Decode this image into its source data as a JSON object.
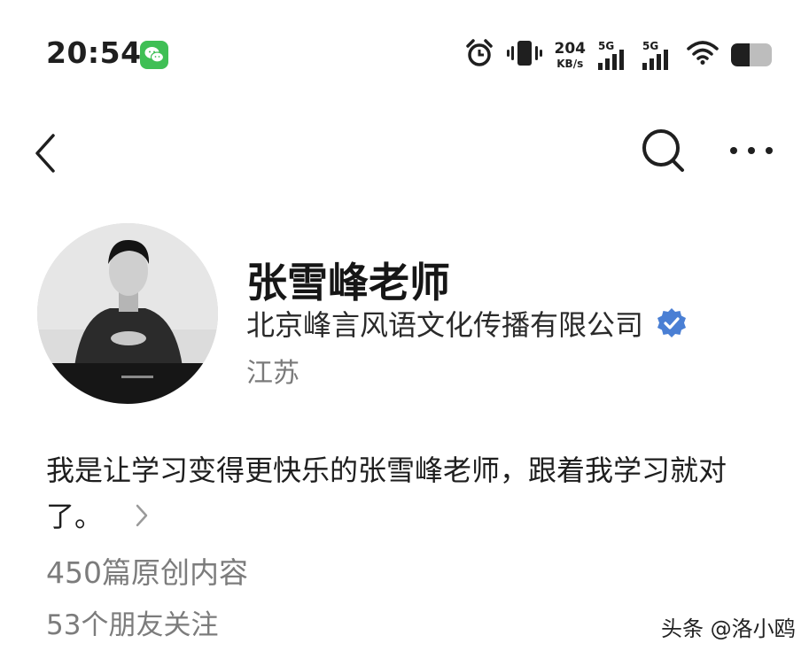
{
  "status_bar": {
    "time": "20:54",
    "net_speed_value": "204",
    "net_speed_unit": "KB/s",
    "signal_1_label": "5G",
    "signal_2_label": "5G",
    "icons": [
      "wechat-icon",
      "alarm-icon",
      "vibrate-icon",
      "signal-icon",
      "wifi-icon",
      "battery-icon"
    ],
    "battery_level": 0.45
  },
  "nav": {
    "icons": [
      "back-icon",
      "search-icon",
      "more-icon"
    ]
  },
  "profile": {
    "name": "张雪峰老师",
    "company": "北京峰言风语文化传播有限公司",
    "location": "江苏",
    "bio": "我是让学习变得更快乐的张雪峰老师，跟着我学习就对了。",
    "stats": {
      "original_content": "450篇原创内容",
      "friends_following": "53个朋友关注"
    }
  },
  "watermark": "头条 @洛小鸥",
  "colors": {
    "wechat": "#3fbf55",
    "verified": "#4a7fd4",
    "secondary_text": "#7c7c7c"
  }
}
